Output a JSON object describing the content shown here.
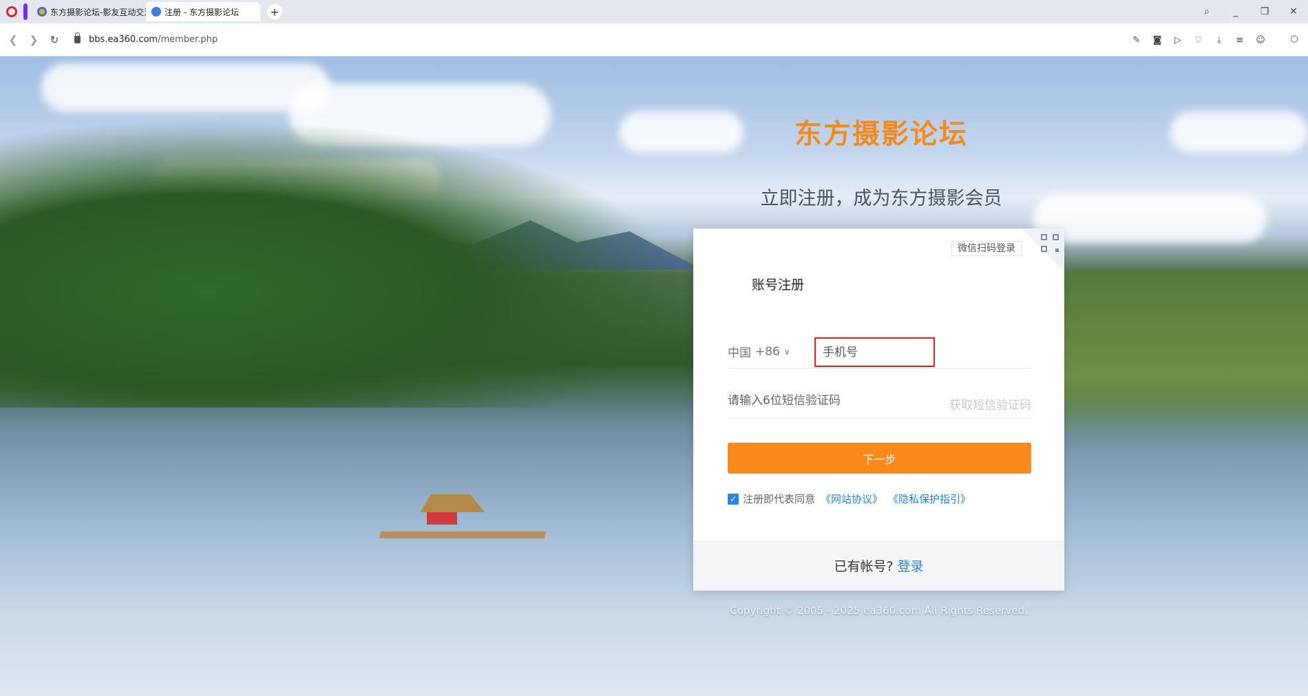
{
  "browser": {
    "tabs": [
      {
        "title": "东方摄影论坛-影友互动交流",
        "active": false
      },
      {
        "title": "注册 - 东方摄影论坛",
        "active": true
      }
    ],
    "new_tab": "+",
    "url_host": "bbs.ea360.com",
    "url_path": "/member.php",
    "icons": [
      "opera-icon",
      "back-icon",
      "forward-icon",
      "reload-icon",
      "lock-icon",
      "search-icon",
      "minimize-icon",
      "restore-icon",
      "snapshot-icon",
      "camera-icon",
      "play-icon",
      "heart-icon",
      "download-icon",
      "menu-icon",
      "account-icon",
      "extensions-icon"
    ]
  },
  "header": {
    "site_title": "东方摄影论坛",
    "subtitle": "立即注册，成为东方摄影会员"
  },
  "register": {
    "wechat_tip": "微信扫码登录",
    "title": "账号注册",
    "country": "中国",
    "dial_code": "+86",
    "phone_placeholder": "手机号",
    "sms_placeholder": "请输入6位短信验证码",
    "get_code": "获取短信验证码",
    "next_button": "下一步",
    "agree_text": "注册即代表同意",
    "agree_checked": true,
    "terms_link": "《网站协议》",
    "privacy_link": "《隐私保护指引》",
    "has_account": "已有帐号?",
    "login_link": "登录"
  },
  "footer": {
    "copyright": "Copyright © 2005 - 2025  ea360.com  All Rights Reserved."
  },
  "colors": {
    "accent": "#f8891a",
    "title": "#f38a1e",
    "link": "#2a7fd4",
    "error_border": "#d92121"
  }
}
